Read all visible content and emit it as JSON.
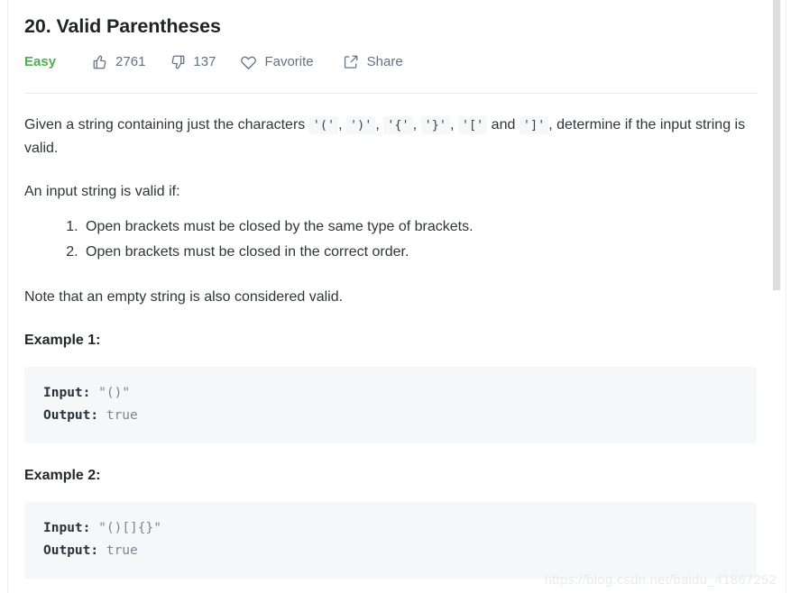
{
  "problem": {
    "title": "20. Valid Parentheses",
    "difficulty": "Easy",
    "likes": "2761",
    "dislikes": "137",
    "favorite_label": "Favorite",
    "share_label": "Share",
    "icons": {
      "like": "thumbs-up-icon",
      "dislike": "thumbs-down-icon",
      "favorite": "heart-icon",
      "share": "share-icon"
    },
    "accent_color": "#4caf50",
    "meta_text_color": "#607285"
  },
  "description": {
    "intro_prefix": "Given a string containing just the characters ",
    "chars": [
      "'('",
      "')'",
      "'{'",
      "'}'",
      "'['",
      "']'"
    ],
    "sep": ", ",
    "and_word": " and ",
    "intro_suffix": ", determine if the input string is valid.",
    "valid_if": "An input string is valid if:",
    "rules": [
      "Open brackets must be closed by the same type of brackets.",
      "Open brackets must be closed in the correct order."
    ],
    "note": "Note that an empty string is also considered valid."
  },
  "examples": [
    {
      "heading": "Example 1:",
      "input_label": "Input:",
      "input_value": "\"()\"",
      "output_label": "Output:",
      "output_value": "true"
    },
    {
      "heading": "Example 2:",
      "input_label": "Input:",
      "input_value": "\"()[]{}\"",
      "output_label": "Output:",
      "output_value": "true"
    }
  ],
  "watermark": "https://blog.csdn.net/baidu_41867252"
}
